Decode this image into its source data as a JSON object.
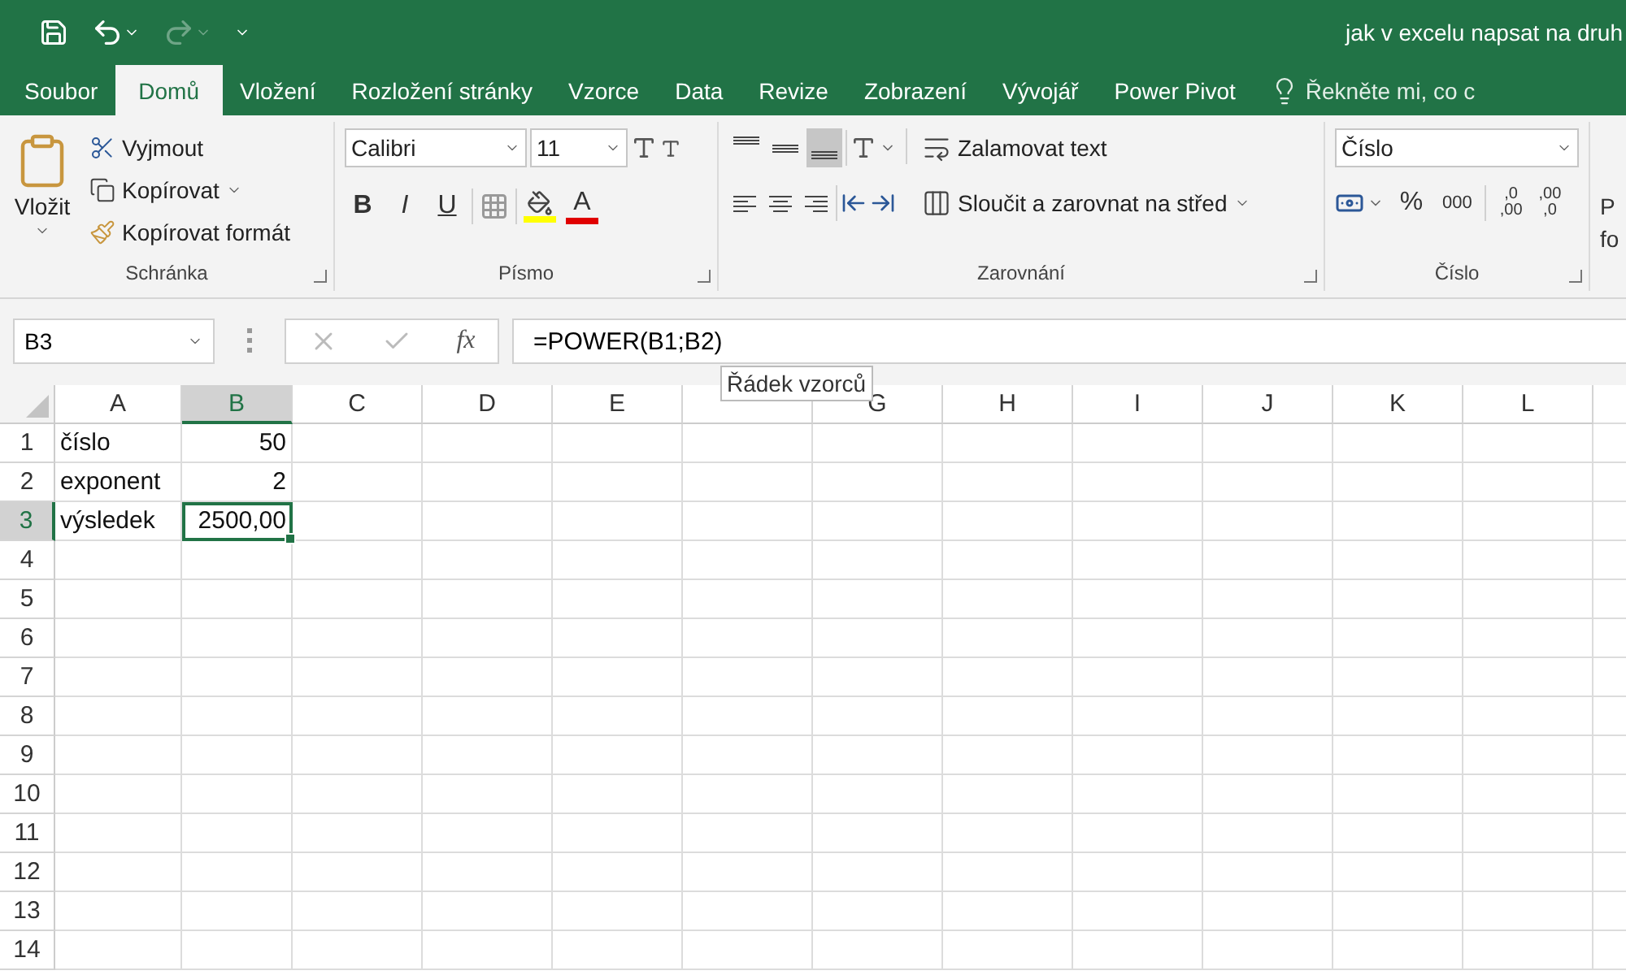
{
  "window": {
    "title": "jak v excelu napsat na druh"
  },
  "tabs": [
    {
      "label": "Soubor",
      "selected": false
    },
    {
      "label": "Domů",
      "selected": true
    },
    {
      "label": "Vložení",
      "selected": false
    },
    {
      "label": "Rozložení stránky",
      "selected": false
    },
    {
      "label": "Vzorce",
      "selected": false
    },
    {
      "label": "Data",
      "selected": false
    },
    {
      "label": "Revize",
      "selected": false
    },
    {
      "label": "Zobrazení",
      "selected": false
    },
    {
      "label": "Vývojář",
      "selected": false
    },
    {
      "label": "Power Pivot",
      "selected": false
    }
  ],
  "tell_me": {
    "placeholder": "Řekněte mi, co c"
  },
  "clipboard": {
    "label": "Schránka",
    "paste": "Vložit",
    "cut": "Vyjmout",
    "copy": "Kopírovat",
    "format_painter": "Kopírovat formát"
  },
  "font": {
    "label": "Písmo",
    "name": "Calibri",
    "size": "11",
    "bold": "B",
    "italic": "I",
    "underline": "U",
    "font_color_glyph": "A"
  },
  "alignment": {
    "label": "Zarovnání",
    "vertical": [
      {
        "kind": "top",
        "selected": false
      },
      {
        "kind": "middle",
        "selected": false
      },
      {
        "kind": "bottom",
        "selected": true
      }
    ],
    "horizontal": [
      {
        "kind": "left",
        "selected": false
      },
      {
        "kind": "center",
        "selected": false
      },
      {
        "kind": "right",
        "selected": false
      }
    ],
    "wrap": "Zalamovat text",
    "merge": "Sloučit a zarovnat na střed"
  },
  "number": {
    "label": "Číslo",
    "format": "Číslo",
    "percent": "%",
    "thousands": "000",
    "increase_decimal": [
      ",0",
      ",00"
    ],
    "decrease_decimal": [
      ",00",
      ",0"
    ]
  },
  "next_group": {
    "line_1": "P",
    "line_2": "fo"
  },
  "formula_bar": {
    "name_box": "B3",
    "insert_function": "fx",
    "formula": "=POWER(B1;B2)",
    "tooltip": "Řádek vzorců"
  },
  "columns": [
    {
      "label": "A",
      "selected": false
    },
    {
      "label": "B",
      "selected": true
    },
    {
      "label": "C",
      "selected": false
    },
    {
      "label": "D",
      "selected": false
    },
    {
      "label": "E",
      "selected": false
    },
    {
      "selected": false
    },
    {
      "label": "G",
      "selected": false
    },
    {
      "label": "H",
      "selected": false
    },
    {
      "label": "I",
      "selected": false
    },
    {
      "label": "J",
      "selected": false
    },
    {
      "label": "K",
      "selected": false
    },
    {
      "label": "L",
      "selected": false
    }
  ],
  "rows": [
    {
      "label": "1",
      "selected": false,
      "cells": [
        {
          "text": "číslo",
          "kind": "text",
          "active": false
        },
        {
          "text": "50",
          "kind": "number",
          "active": false
        }
      ]
    },
    {
      "label": "2",
      "selected": false,
      "cells": [
        {
          "text": "exponent",
          "kind": "text",
          "active": false
        },
        {
          "text": "2",
          "kind": "number",
          "active": false
        }
      ]
    },
    {
      "label": "3",
      "selected": true,
      "cells": [
        {
          "text": "výsledek",
          "kind": "text",
          "active": false
        },
        {
          "text": "2500,00",
          "kind": "number",
          "active": true
        }
      ]
    },
    {
      "label": "4",
      "selected": false
    },
    {
      "label": "5",
      "selected": false
    },
    {
      "label": "6",
      "selected": false
    },
    {
      "label": "7",
      "selected": false
    },
    {
      "label": "8",
      "selected": false
    },
    {
      "label": "9",
      "selected": false
    },
    {
      "label": "10",
      "selected": false
    },
    {
      "label": "11",
      "selected": false
    },
    {
      "label": "12",
      "selected": false
    },
    {
      "label": "13",
      "selected": false
    },
    {
      "label": "14",
      "selected": false
    }
  ]
}
